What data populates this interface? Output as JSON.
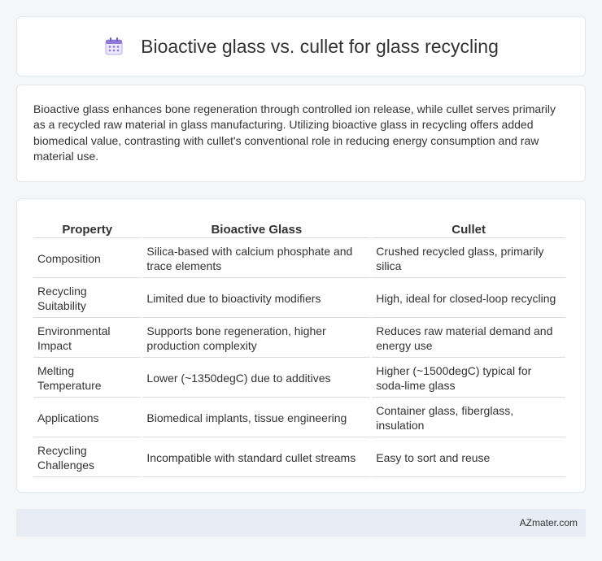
{
  "header": {
    "title": "Bioactive glass vs. cullet for glass recycling",
    "icon": "calendar-icon",
    "icon_color": "#8f7bd6"
  },
  "summary": {
    "text": "Bioactive glass enhances bone regeneration through controlled ion release, while cullet serves primarily as a recycled raw material in glass manufacturing. Utilizing bioactive glass in recycling offers added biomedical value, contrasting with cullet's conventional role in reducing energy consumption and raw material use."
  },
  "table": {
    "headers": [
      "Property",
      "Bioactive Glass",
      "Cullet"
    ],
    "rows": [
      [
        "Composition",
        "Silica-based with calcium phosphate and trace elements",
        "Crushed recycled glass, primarily silica"
      ],
      [
        "Recycling Suitability",
        "Limited due to bioactivity modifiers",
        "High, ideal for closed-loop recycling"
      ],
      [
        "Environmental Impact",
        "Supports bone regeneration, higher production complexity",
        "Reduces raw material demand and energy use"
      ],
      [
        "Melting Temperature",
        "Lower (~1350degC) due to additives",
        "Higher (~1500degC) typical for soda-lime glass"
      ],
      [
        "Applications",
        "Biomedical implants, tissue engineering",
        "Container glass, fiberglass, insulation"
      ],
      [
        "Recycling Challenges",
        "Incompatible with standard cullet streams",
        "Easy to sort and reuse"
      ]
    ]
  },
  "footer": {
    "brand": "AZmater.com"
  },
  "colors": {
    "background": "#f5f6f8",
    "card": "#ffffff",
    "footer_bg": "#e7ecf5",
    "text": "#333333"
  }
}
